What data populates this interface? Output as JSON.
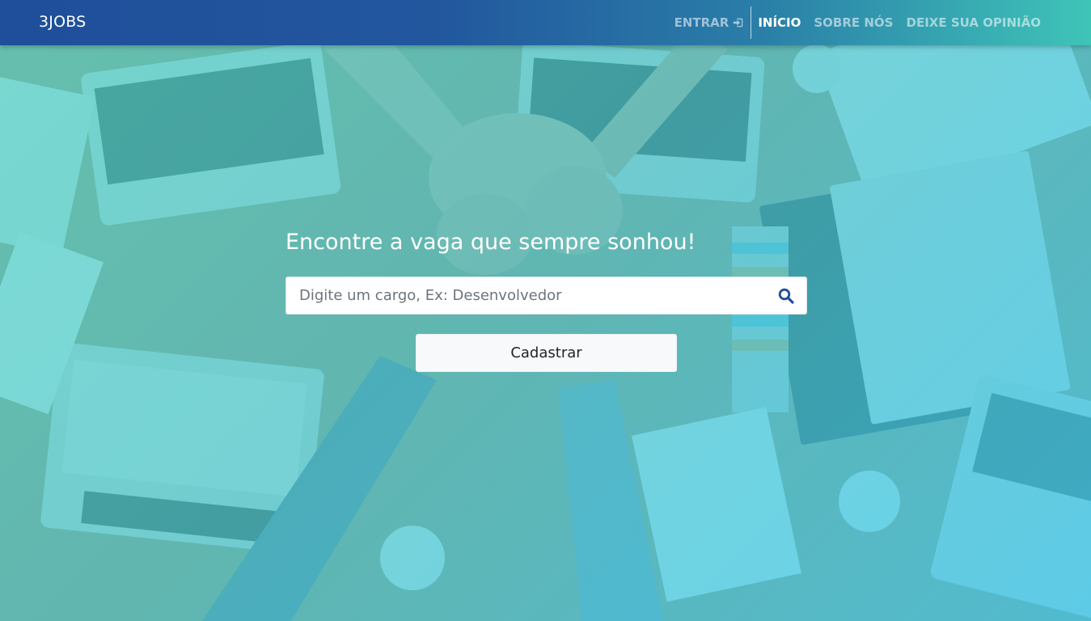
{
  "navbar": {
    "brand": "3JOBS",
    "login_label": "ENTRAR",
    "login_icon": "sign-in-icon",
    "links": [
      {
        "label": "INÍCIO",
        "active": true
      },
      {
        "label": "SOBRE NÓS",
        "active": false
      },
      {
        "label": "DEIXE SUA OPINIÃO",
        "active": false
      }
    ]
  },
  "hero": {
    "headline": "Encontre a vaga que sempre sonhou!",
    "search": {
      "placeholder": "Digite um cargo, Ex: Desenvolvedor",
      "value": "",
      "icon": "search-icon"
    },
    "register_label": "Cadastrar"
  },
  "colors": {
    "navbar_start": "#1f4e9a",
    "navbar_end": "#3fc4b8",
    "overlay": "#4fc9cf",
    "search_icon": "#1f4e9a"
  }
}
